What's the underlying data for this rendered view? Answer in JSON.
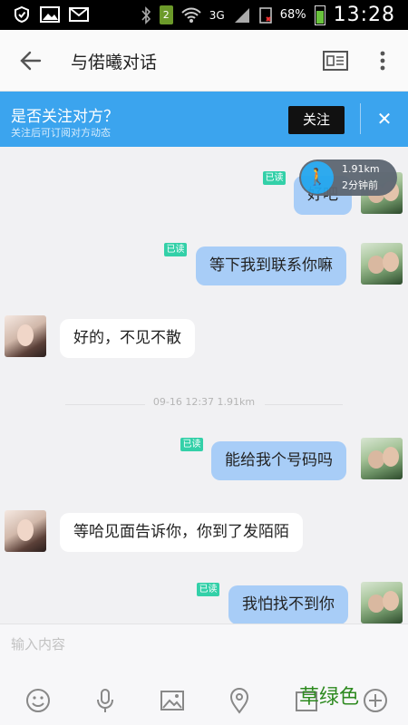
{
  "status_bar": {
    "network": "3G",
    "battery_percent": "68%",
    "time": "13:28",
    "sim_label": "2"
  },
  "header": {
    "title": "与偌曦对话"
  },
  "follow_banner": {
    "title": "是否关注对方？",
    "subtitle": "关注后可订阅对方动态",
    "follow_label": "关注",
    "close_label": "✕"
  },
  "distance_pill": {
    "distance": "1.91km",
    "time_ago": "2分钟前"
  },
  "messages": [
    {
      "side": "out",
      "text": "好吧",
      "read": "已读"
    },
    {
      "side": "out",
      "text": "等下我到联系你嘛",
      "read": "已读"
    },
    {
      "side": "in",
      "text": "好的，不见不散"
    },
    {
      "side": "out",
      "text": "能给我个号码吗",
      "read": "已读"
    },
    {
      "side": "in",
      "text": "等哈见面告诉你，你到了发陌陌"
    },
    {
      "side": "out",
      "text": "我怕找不到你",
      "read": "已读"
    }
  ],
  "timestamp": "09-16 12:37   1.91km",
  "input": {
    "placeholder": "输入内容"
  },
  "toolbar_icons": [
    "emoji-icon",
    "microphone-icon",
    "image-icon",
    "location-icon",
    "camera-icon",
    "plus-icon"
  ],
  "watermark": "草绿色",
  "colors": {
    "accent": "#3ba4ee",
    "outgoing_bubble": "#a8cdf7",
    "read_badge": "#33d0a8"
  }
}
